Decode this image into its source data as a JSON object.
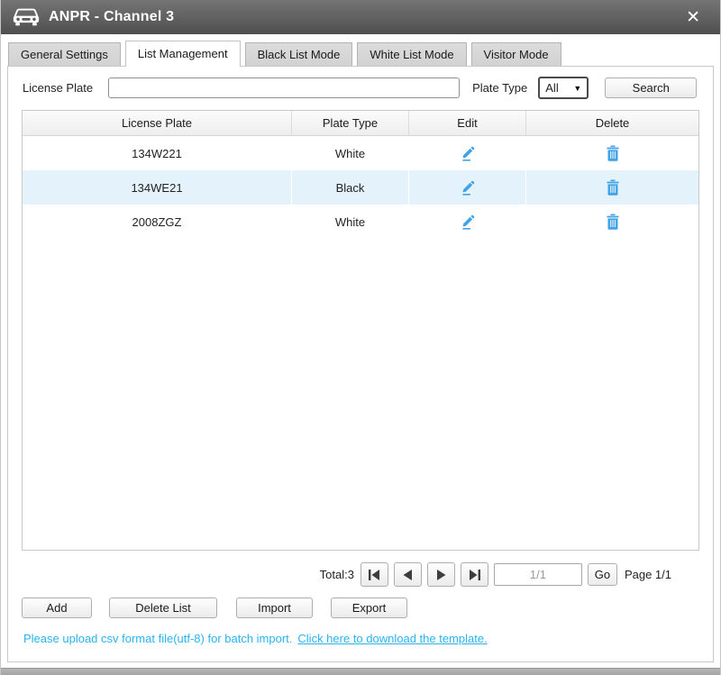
{
  "window": {
    "title": "ANPR - Channel 3",
    "close_glyph": "✕"
  },
  "tabs": [
    {
      "label": "General Settings",
      "active": false
    },
    {
      "label": "List Management",
      "active": true
    },
    {
      "label": "Black List Mode",
      "active": false
    },
    {
      "label": "White List Mode",
      "active": false
    },
    {
      "label": "Visitor Mode",
      "active": false
    }
  ],
  "search": {
    "license_plate_label": "License Plate",
    "license_plate_value": "",
    "plate_type_label": "Plate Type",
    "plate_type_value": "All",
    "dropdown_arrow": "▼",
    "search_button": "Search"
  },
  "table": {
    "headers": [
      "License Plate",
      "Plate Type",
      "Edit",
      "Delete"
    ],
    "rows": [
      {
        "plate": "134W221",
        "type": "White"
      },
      {
        "plate": "134WE21",
        "type": "Black"
      },
      {
        "plate": "2008ZGZ",
        "type": "White"
      }
    ]
  },
  "pagination": {
    "total_label": "Total:3",
    "page_input_value": "1/1",
    "go_button": "Go",
    "page_label": "Page 1/1"
  },
  "actions": {
    "add": "Add",
    "delete_list": "Delete List",
    "import": "Import",
    "export": "Export"
  },
  "footer": {
    "note": "Please upload csv format file(utf-8) for batch import.",
    "link": "Click here to download the template."
  },
  "colors": {
    "titlebar_top": "#757575",
    "titlebar_bottom": "#4f4f4f",
    "icon_blue": "#41a3e6",
    "row_highlight": "#e4f3fb",
    "footer_blue": "#29b3ef"
  }
}
